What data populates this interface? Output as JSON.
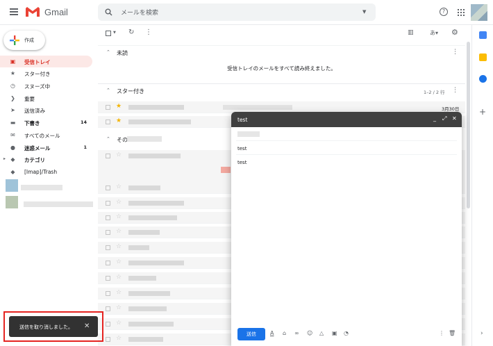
{
  "app": {
    "name": "Gmail"
  },
  "search": {
    "placeholder": "メールを検索"
  },
  "compose_label": "作成",
  "nav": [
    {
      "label": "受信トレイ",
      "icon": "inbox-icon",
      "active": true
    },
    {
      "label": "スター付き",
      "icon": "star-icon"
    },
    {
      "label": "スヌーズ中",
      "icon": "clock-icon"
    },
    {
      "label": "重要",
      "icon": "important-icon"
    },
    {
      "label": "送信済み",
      "icon": "send-icon"
    },
    {
      "label": "下書き",
      "icon": "draft-icon",
      "count": "14",
      "bold": true
    },
    {
      "label": "すべてのメール",
      "icon": "mail-icon"
    },
    {
      "label": "迷惑メール",
      "icon": "spam-icon",
      "count": "1",
      "bold": true
    },
    {
      "label": "カテゴリ",
      "icon": "label-icon",
      "bold": true
    },
    {
      "label": "[Imap]/Trash",
      "icon": "label-icon"
    }
  ],
  "sections": {
    "unread": "未読",
    "unread_empty": "受信トレイのメールをすべて読み終えました。",
    "starred": "スター付き",
    "starred_range": "1–2 / 2 行",
    "starred_date": "3月30日",
    "other": "その"
  },
  "compose_window": {
    "title": "test",
    "subject": "test",
    "body": "test",
    "send_label": "送信"
  },
  "snackbar": {
    "message": "送信を取り消しました。",
    "close": "✕"
  },
  "colors": {
    "accent": "#d93025",
    "send": "#1a73e8",
    "highlight": "#e52320"
  }
}
